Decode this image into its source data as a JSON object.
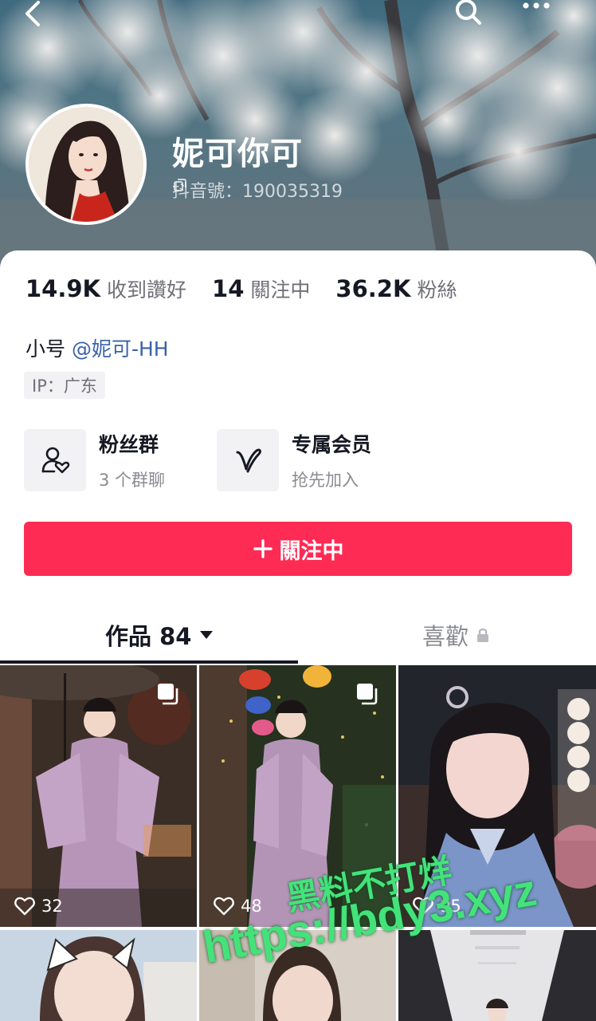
{
  "profile": {
    "nickname": "妮可你可",
    "douyin_id": "抖音號：190035319"
  },
  "stats": [
    {
      "value": "14.9K",
      "label": "收到讚好"
    },
    {
      "value": "14",
      "label": "關注中"
    },
    {
      "value": "36.2K",
      "label": "粉絲"
    }
  ],
  "bio": {
    "prefix": "小号",
    "mention": "@妮可-HH"
  },
  "ip": "IP：广东",
  "features": {
    "fan_group": {
      "title": "粉丝群",
      "subtitle": "3 个群聊",
      "icon": "user-heart-icon"
    },
    "vip": {
      "title": "专属会员",
      "subtitle": "抢先加入",
      "icon": "v-icon"
    }
  },
  "follow_button": {
    "label": "關注中",
    "icon": "plus-icon"
  },
  "tabs": {
    "works": "作品 84",
    "likes": "喜歡"
  },
  "grid": {
    "tiles": [
      {
        "likes": "32",
        "multi": true
      },
      {
        "likes": "48",
        "multi": true
      },
      {
        "likes": "95",
        "multi": false
      },
      {
        "likes": "",
        "multi": false
      },
      {
        "likes": "",
        "multi": false
      },
      {
        "likes": "",
        "multi": false
      }
    ]
  },
  "watermark": {
    "line1": "黑料不打烊",
    "line2": "https://bdy3.xyz"
  },
  "colors": {
    "accent": "#fe2c55",
    "mention": "#3a62a8",
    "watermark": "#43e37a"
  }
}
